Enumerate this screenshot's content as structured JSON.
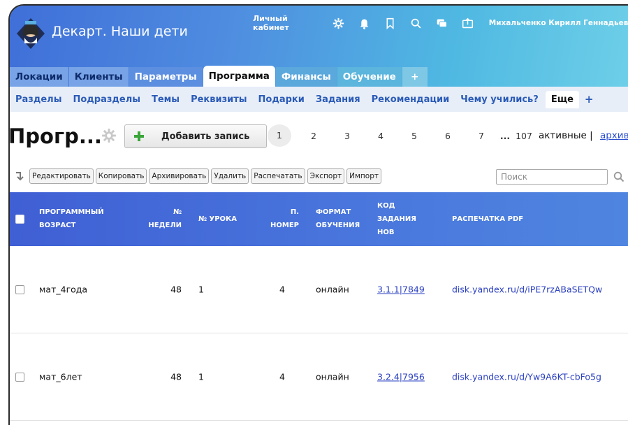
{
  "app": {
    "title": "Декарт. Наши дети"
  },
  "topnav": {
    "cabinet": "Личный кабинет",
    "user": "Михальченко Кирилл Геннадьевич",
    "icons": [
      "gear-icon",
      "bell-icon",
      "bookmark-icon",
      "search-icon",
      "chat-icon",
      "share-icon"
    ]
  },
  "tabs": [
    {
      "label": "Локации"
    },
    {
      "label": "Клиенты"
    },
    {
      "label": "Параметры"
    },
    {
      "label": "Программа",
      "active": true
    },
    {
      "label": "Финансы"
    },
    {
      "label": "Обучение"
    },
    {
      "label": "+"
    }
  ],
  "subtabs": [
    {
      "label": "Разделы"
    },
    {
      "label": "Подразделы"
    },
    {
      "label": "Темы"
    },
    {
      "label": "Реквизиты"
    },
    {
      "label": "Подарки"
    },
    {
      "label": "Задания"
    },
    {
      "label": "Рекомендации"
    },
    {
      "label": "Чему учились?"
    },
    {
      "label": "Еще",
      "active": true
    },
    {
      "label": "+"
    }
  ],
  "page": {
    "title": "Прогр...",
    "add_label": "Добавить запись",
    "status": "активные",
    "separator": "|",
    "archive": "архив"
  },
  "pager": {
    "pages": [
      "1",
      "2",
      "3",
      "4",
      "5",
      "6",
      "7"
    ],
    "current": "1",
    "ellipsis": "...",
    "last": "107"
  },
  "toolbar": {
    "buttons": [
      "Редактировать",
      "Копировать",
      "Архивировать",
      "Удалить",
      "Распечатать",
      "Экспорт",
      "Импорт"
    ],
    "search_placeholder": "Поиск"
  },
  "table": {
    "headers": {
      "age": [
        "ПРОГРАММНЫЙ",
        "ВОЗРАСТ"
      ],
      "week": [
        "№",
        "НЕДЕЛИ"
      ],
      "lesson": [
        "№ УРОКА"
      ],
      "num": [
        "П.",
        "НОМЕР"
      ],
      "format": [
        "ФОРМАТ",
        "ОБУЧЕНИЯ"
      ],
      "code": [
        "КОД",
        "ЗАДАНИЯ",
        "НОВ"
      ],
      "pdf": [
        "РАСПЕЧАТКА PDF"
      ]
    },
    "rows": [
      {
        "age": "мат_4года",
        "week": "48",
        "lesson": "1",
        "num": "4",
        "format": "онлайн",
        "code": "3.1.1|7849",
        "pdf": "disk.yandex.ru/d/iPE7rzABaSETQw"
      },
      {
        "age": "мат_6лет",
        "week": "48",
        "lesson": "1",
        "num": "4",
        "format": "онлайн",
        "code": "3.2.4|7956",
        "pdf": "disk.yandex.ru/d/Yw9A6KT-cbFo5g"
      }
    ]
  },
  "colors": {
    "header_start": "#3f6fd8",
    "header_end": "#6fd0e8",
    "table_header": "#4a78dd",
    "link": "#2a3fc0"
  }
}
